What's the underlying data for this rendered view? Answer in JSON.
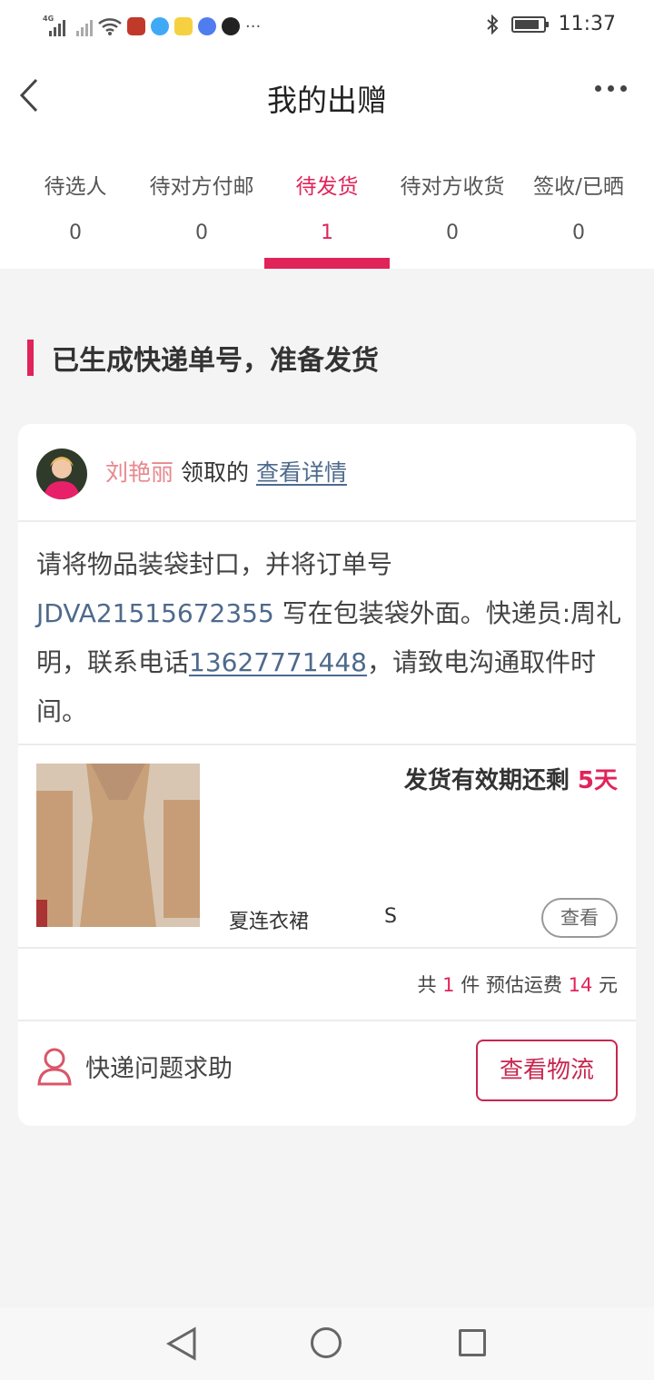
{
  "status_bar": {
    "network": "4G",
    "time": "11:37",
    "more": "···"
  },
  "header": {
    "title": "我的出赠"
  },
  "tabs": [
    {
      "label": "待选人",
      "count": "0"
    },
    {
      "label": "待对方付邮",
      "count": "0"
    },
    {
      "label": "待发货",
      "count": "1"
    },
    {
      "label": "待对方收货",
      "count": "0"
    },
    {
      "label": "签收/已晒",
      "count": "0"
    }
  ],
  "active_tab": "待发货",
  "section": {
    "title": "已生成快递单号，准备发货"
  },
  "card": {
    "user": {
      "name": "刘艳丽",
      "action": "领取的",
      "detail_link": "查看详情"
    },
    "notice": {
      "prefix": "请将物品装袋封口，并将订单号",
      "order_no": "JDVA21515672355",
      "middle": "写在包装袋外面。快递员:周礼明，联系电话",
      "phone": "13627771448",
      "suffix": "，请致电沟通取件时间。"
    },
    "item": {
      "deadline_label": "发货有效期还剩",
      "deadline_value": "5天",
      "name": "夏连衣裙",
      "size": "S",
      "view_label": "查看"
    },
    "summary": {
      "prefix": "共",
      "count": "1",
      "middle": "件 预估运费",
      "fee": "14",
      "unit": "元"
    },
    "help_label": "快递问题求助",
    "logistics_label": "查看物流"
  }
}
